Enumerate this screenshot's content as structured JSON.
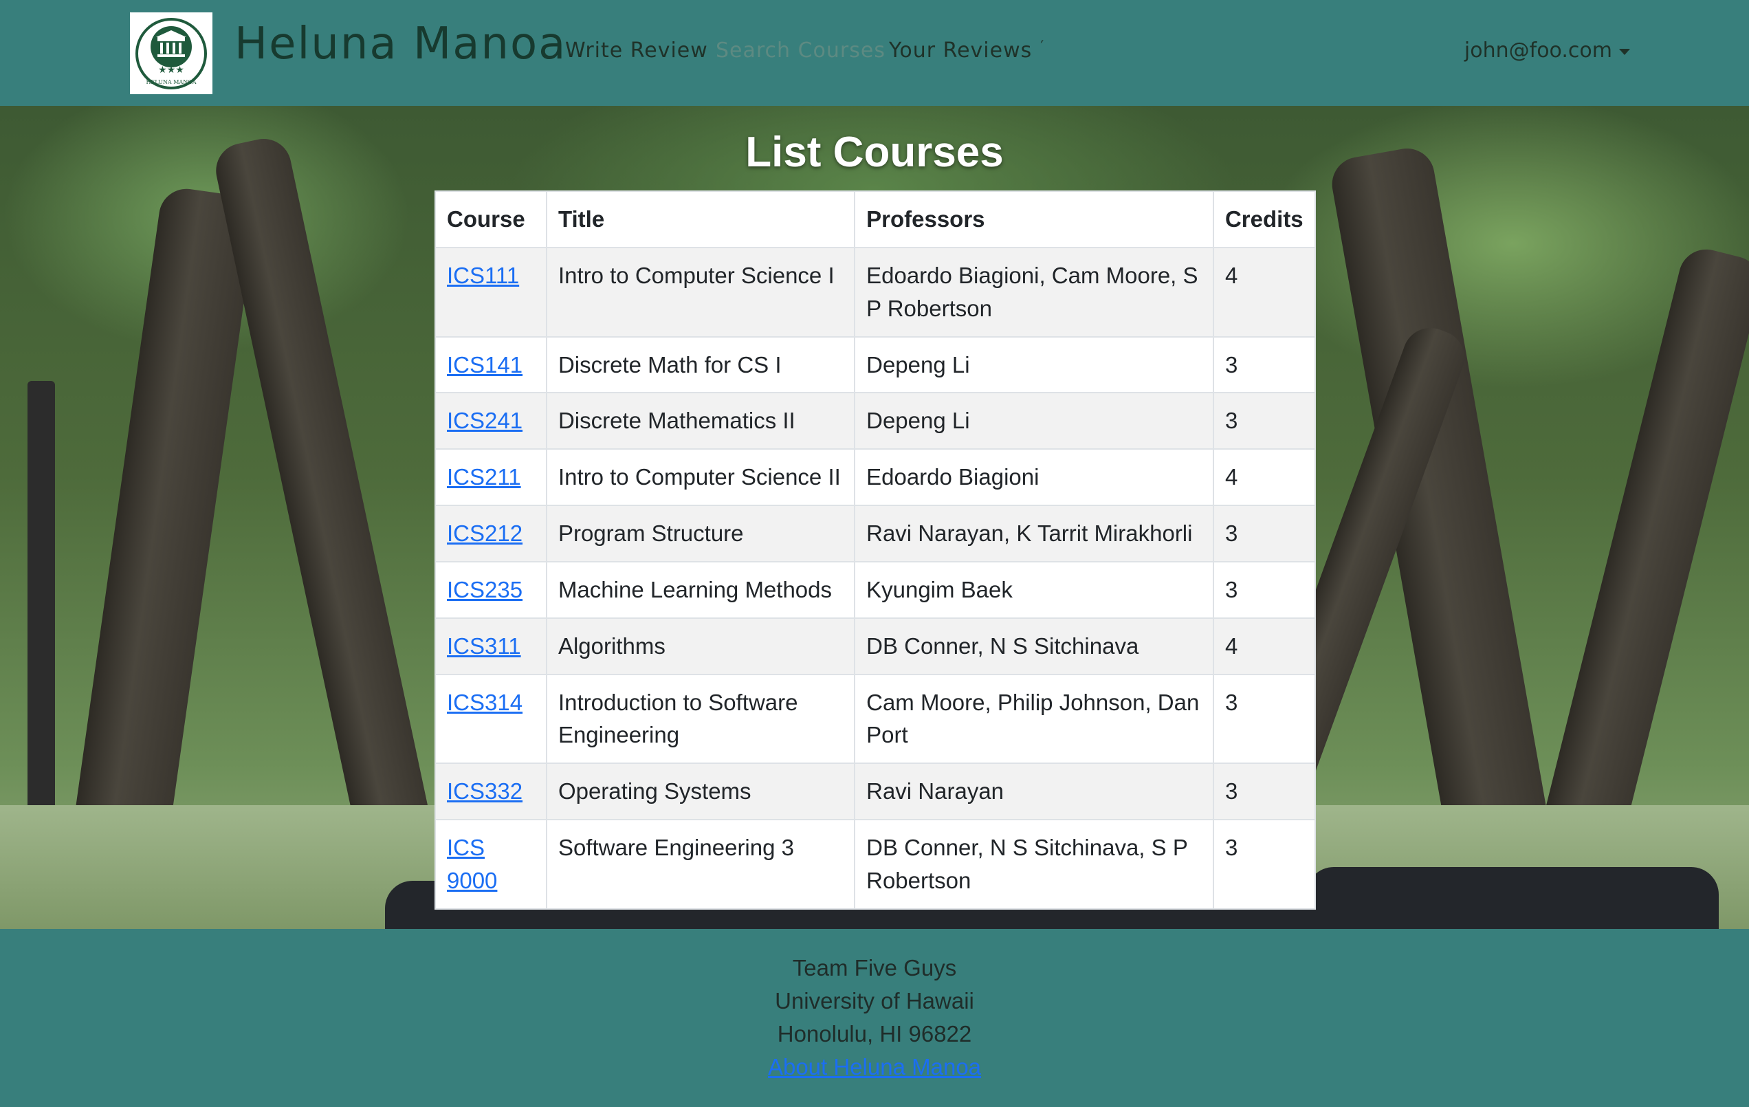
{
  "navbar": {
    "brand": "Heluna Manoa",
    "logo_text": "HELUNA MANOA",
    "links": [
      "Write Review",
      "Search Courses",
      "Your Reviews"
    ],
    "user_email": "john@foo.com",
    "colors": {
      "bar": "#387f7c",
      "brand_text": "#173a2f"
    }
  },
  "main": {
    "title": "List Courses",
    "columns": [
      "Course",
      "Title",
      "Professors",
      "Credits"
    ],
    "rows": [
      {
        "course": "ICS111",
        "title": "Intro to Computer Science I",
        "professors": "Edoardo Biagioni, Cam Moore, S P Robertson",
        "credits": "4"
      },
      {
        "course": "ICS141",
        "title": "Discrete Math for CS I",
        "professors": "Depeng Li",
        "credits": "3"
      },
      {
        "course": "ICS241",
        "title": "Discrete Mathematics II",
        "professors": "Depeng Li",
        "credits": "3"
      },
      {
        "course": "ICS211",
        "title": "Intro to Computer Science II",
        "professors": "Edoardo Biagioni",
        "credits": "4"
      },
      {
        "course": "ICS212",
        "title": "Program Structure",
        "professors": "Ravi Narayan, K Tarrit Mirakhorli",
        "credits": "3"
      },
      {
        "course": "ICS235",
        "title": "Machine Learning Methods",
        "professors": "Kyungim Baek",
        "credits": "3"
      },
      {
        "course": "ICS311",
        "title": "Algorithms",
        "professors": "DB Conner, N S Sitchinava",
        "credits": "4"
      },
      {
        "course": "ICS314",
        "title": "Introduction to Software Engineering",
        "professors": "Cam Moore, Philip Johnson, Dan Port",
        "credits": "3"
      },
      {
        "course": "ICS332",
        "title": "Operating Systems",
        "professors": "Ravi Narayan",
        "credits": "3"
      },
      {
        "course": "ICS 9000",
        "title": "Software Engineering 3",
        "professors": "DB Conner, N S Sitchinava, S P Robertson",
        "credits": "3"
      }
    ]
  },
  "footer": {
    "team": "Team Five Guys",
    "university": "University of Hawaii",
    "address": "Honolulu, HI 96822",
    "about_link": "About Heluna Manoa"
  }
}
